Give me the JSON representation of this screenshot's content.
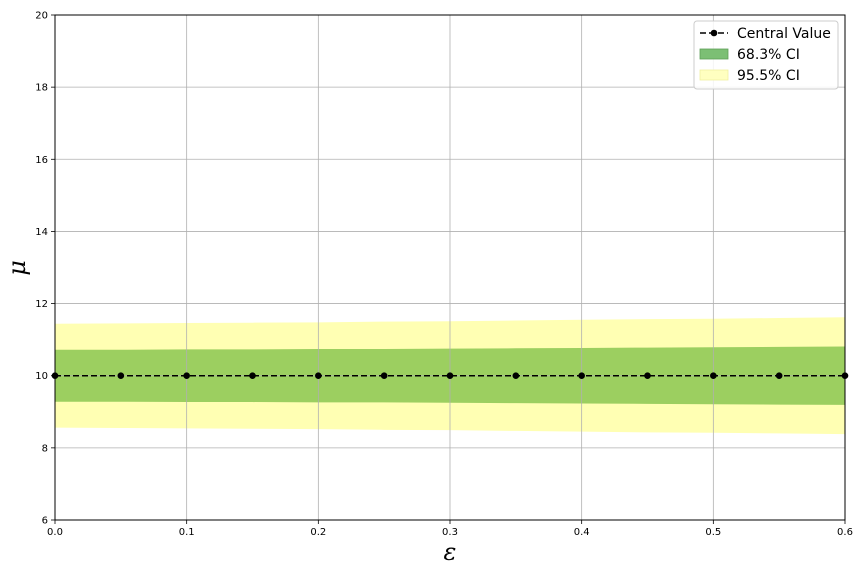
{
  "chart_data": {
    "type": "line",
    "xlabel": "ε",
    "ylabel": "μ",
    "xlim": [
      0.0,
      0.6
    ],
    "ylim": [
      6,
      20
    ],
    "xticks": [
      0.0,
      0.1,
      0.2,
      0.3,
      0.4,
      0.5,
      0.6
    ],
    "xtick_labels": [
      "0.0",
      "0.1",
      "0.2",
      "0.3",
      "0.4",
      "0.5",
      "0.6"
    ],
    "yticks": [
      6,
      8,
      10,
      12,
      14,
      16,
      18,
      20
    ],
    "ytick_labels": [
      "6",
      "8",
      "10",
      "12",
      "14",
      "16",
      "18",
      "20"
    ],
    "grid": true,
    "legend_position": "top-right",
    "x": [
      0.0,
      0.05,
      0.1,
      0.15,
      0.2,
      0.25,
      0.3,
      0.35,
      0.4,
      0.45,
      0.5,
      0.55,
      0.6
    ],
    "series": [
      {
        "name": "Central Value",
        "style": "dashed-line-with-markers",
        "color": "#000000",
        "values": [
          10,
          10,
          10,
          10,
          10,
          10,
          10,
          10,
          10,
          10,
          10,
          10,
          10
        ]
      }
    ],
    "bands": [
      {
        "name": "95.5% CI",
        "color": "#ffffb3",
        "lower": [
          8.56,
          8.55,
          8.54,
          8.53,
          8.52,
          8.5,
          8.49,
          8.47,
          8.45,
          8.43,
          8.42,
          8.4,
          8.38
        ],
        "upper": [
          11.44,
          11.45,
          11.46,
          11.47,
          11.48,
          11.5,
          11.51,
          11.53,
          11.55,
          11.57,
          11.58,
          11.6,
          11.62
        ]
      },
      {
        "name": "68.3% CI",
        "color": "#9ccf60",
        "lower": [
          9.28,
          9.28,
          9.27,
          9.27,
          9.26,
          9.26,
          9.25,
          9.24,
          9.23,
          9.22,
          9.21,
          9.2,
          9.19
        ],
        "upper": [
          10.72,
          10.72,
          10.73,
          10.73,
          10.74,
          10.74,
          10.75,
          10.76,
          10.77,
          10.78,
          10.79,
          10.8,
          10.81
        ]
      }
    ],
    "legend": [
      {
        "label": "Central Value",
        "kind": "line-marker",
        "color": "#000000"
      },
      {
        "label": "68.3% CI",
        "kind": "patch",
        "color": "#7cbf74"
      },
      {
        "label": "95.5% CI",
        "kind": "patch",
        "color": "#ffffc0"
      }
    ]
  }
}
